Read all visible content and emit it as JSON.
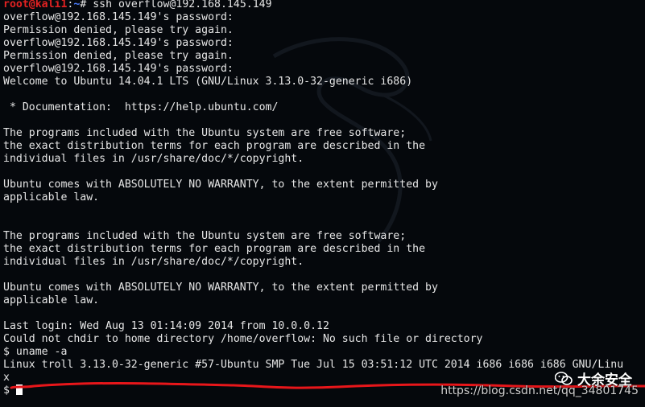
{
  "terminal": {
    "prompt": {
      "user": "root@kali1",
      "sep": ":",
      "path": "~",
      "symbol": "#",
      "command": " ssh overflow@192.168.145.149"
    },
    "output_lines": [
      "overflow@192.168.145.149's password:",
      "Permission denied, please try again.",
      "overflow@192.168.145.149's password:",
      "Permission denied, please try again.",
      "overflow@192.168.145.149's password:",
      "Welcome to Ubuntu 14.04.1 LTS (GNU/Linux 3.13.0-32-generic i686)",
      "",
      " * Documentation:  https://help.ubuntu.com/",
      "",
      "The programs included with the Ubuntu system are free software;",
      "the exact distribution terms for each program are described in the",
      "individual files in /usr/share/doc/*/copyright.",
      "",
      "Ubuntu comes with ABSOLUTELY NO WARRANTY, to the extent permitted by",
      "applicable law.",
      "",
      "",
      "The programs included with the Ubuntu system are free software;",
      "the exact distribution terms for each program are described in the",
      "individual files in /usr/share/doc/*/copyright.",
      "",
      "Ubuntu comes with ABSOLUTELY NO WARRANTY, to the extent permitted by",
      "applicable law.",
      "",
      "Last login: Wed Aug 13 01:14:09 2014 from 10.0.0.12",
      "Could not chdir to home directory /home/overflow: No such file or directory",
      "$ uname -a",
      "Linux troll 3.13.0-32-generic #57-Ubuntu SMP Tue Jul 15 03:51:12 UTC 2014 i686 i686 i686 GNU/Linu",
      "x"
    ],
    "current_prompt": "$ "
  },
  "watermark": {
    "brand": "大余安全",
    "url": "https://blog.csdn.net/qq_34801745"
  },
  "colors": {
    "background": "#05080c",
    "text": "#e6e6e6",
    "prompt_user": "#e32222",
    "prompt_path": "#4a7dff",
    "annotation_red": "#e8161a"
  }
}
